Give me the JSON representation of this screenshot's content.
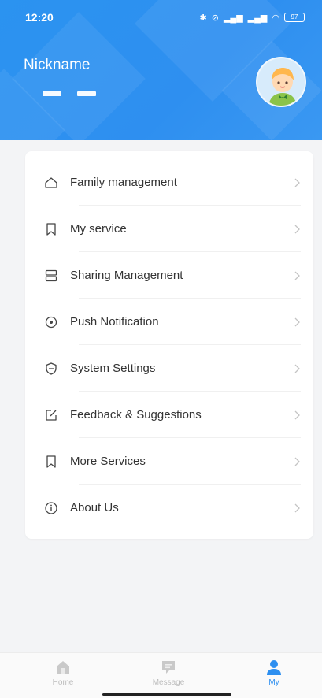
{
  "status_bar": {
    "time": "12:20",
    "battery": "97"
  },
  "profile": {
    "nickname": "Nickname"
  },
  "menu": {
    "items": [
      {
        "label": "Family management",
        "icon": "home-icon"
      },
      {
        "label": "My service",
        "icon": "bookmark-icon"
      },
      {
        "label": "Sharing Management",
        "icon": "server-icon"
      },
      {
        "label": "Push Notification",
        "icon": "notification-icon"
      },
      {
        "label": "System Settings",
        "icon": "shield-icon"
      },
      {
        "label": "Feedback & Suggestions",
        "icon": "edit-icon"
      },
      {
        "label": "More Services",
        "icon": "bookmark-icon"
      },
      {
        "label": "About Us",
        "icon": "info-icon"
      }
    ]
  },
  "bottom_nav": {
    "items": [
      {
        "label": "Home",
        "icon": "home-tab-icon",
        "active": false
      },
      {
        "label": "Message",
        "icon": "message-tab-icon",
        "active": false
      },
      {
        "label": "My",
        "icon": "user-tab-icon",
        "active": true
      }
    ]
  },
  "colors": {
    "accent": "#2d8ff0",
    "header_bg": "#2b93f0",
    "page_bg": "#f3f4f6"
  }
}
